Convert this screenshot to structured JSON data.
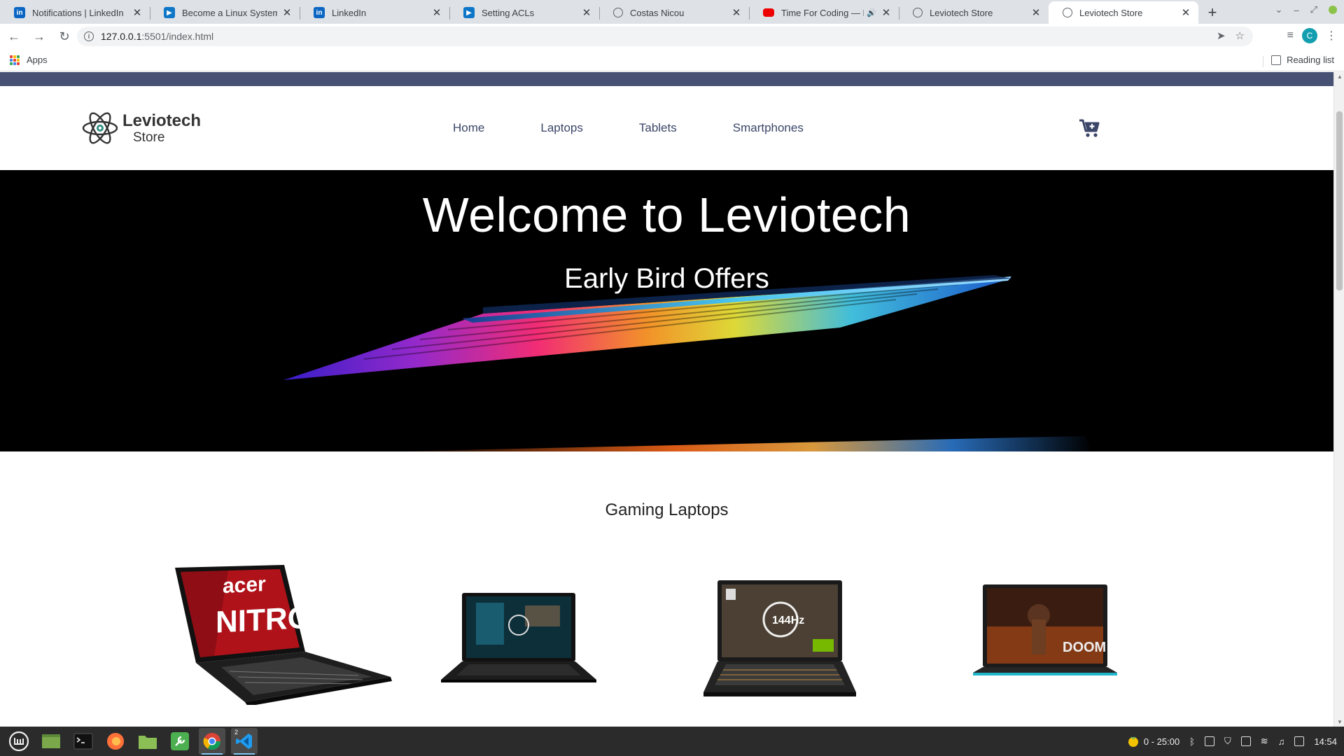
{
  "browser": {
    "tabs": [
      {
        "title": "Notifications | LinkedIn",
        "icon": "linkedin-icon"
      },
      {
        "title": "Become a Linux System Ad",
        "icon": "course-play-icon"
      },
      {
        "title": "LinkedIn",
        "icon": "linkedin-icon"
      },
      {
        "title": "Setting ACLs",
        "icon": "course-play-icon"
      },
      {
        "title": "Costas Nicou",
        "icon": "globe-icon"
      },
      {
        "title": "Time For Coding — Fu",
        "icon": "youtube-icon"
      },
      {
        "title": "Leviotech Store",
        "icon": "globe-icon"
      },
      {
        "title": "Leviotech Store",
        "icon": "globe-icon",
        "active": true
      }
    ],
    "address": "127.0.0.1:5501/index.html",
    "address_host": "127.0.0.1",
    "address_rest": ":5501/index.html",
    "bookmarks": {
      "apps_label": "Apps",
      "reading_list_label": "Reading list"
    },
    "profile_initial": "C"
  },
  "site": {
    "brand_line1": "Leviotech",
    "brand_line2": "Store",
    "nav": [
      "Home",
      "Laptops",
      "Tablets",
      "Smartphones"
    ],
    "hero_title": "Welcome to Leviotech",
    "hero_subtitle": "Early Bird Offers",
    "section_title": "Gaming Laptops",
    "products": [
      {
        "name": "acer-nitro-laptop",
        "screen_text_1": "acer",
        "screen_text_2": "NITRO"
      },
      {
        "name": "msi-laptop"
      },
      {
        "name": "asus-tuf-laptop",
        "screen_text_1": "144Hz"
      },
      {
        "name": "dell-g15-laptop",
        "screen_text_1": "DOOM"
      }
    ],
    "colors": {
      "stripe": "#475173",
      "nav_text": "#3b4668",
      "hero_bg": "#000000"
    }
  },
  "taskbar": {
    "timer": "0 - 25:00",
    "clock": "14:54",
    "vscode_badge": "2"
  }
}
